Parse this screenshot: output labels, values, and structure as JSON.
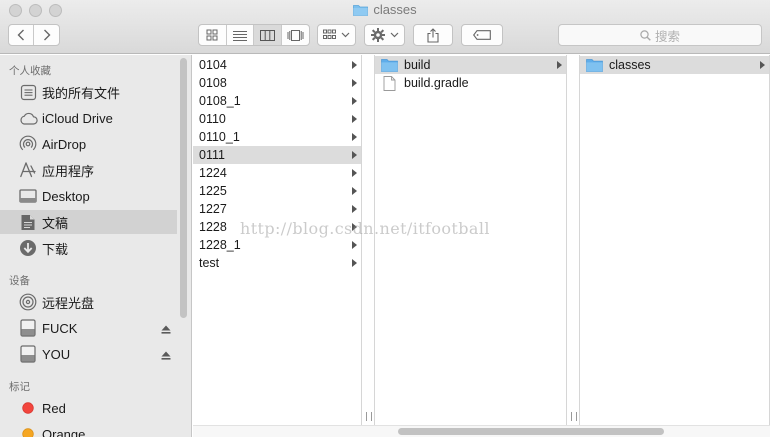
{
  "window": {
    "title": "classes"
  },
  "toolbar": {
    "search_placeholder": "搜索"
  },
  "sidebar": {
    "favorites_header": "个人收藏",
    "favorites": [
      {
        "label": "我的所有文件",
        "icon": "all-files-icon"
      },
      {
        "label": "iCloud Drive",
        "icon": "cloud-icon"
      },
      {
        "label": "AirDrop",
        "icon": "airdrop-icon"
      },
      {
        "label": "应用程序",
        "icon": "applications-icon"
      },
      {
        "label": "Desktop",
        "icon": "desktop-icon"
      },
      {
        "label": "文稿",
        "icon": "documents-icon",
        "selected": true
      },
      {
        "label": "下载",
        "icon": "downloads-icon"
      }
    ],
    "devices_header": "设备",
    "devices": [
      {
        "label": "远程光盘",
        "icon": "remote-disc-icon"
      },
      {
        "label": "FUCK",
        "icon": "drive-icon",
        "eject": true
      },
      {
        "label": "YOU",
        "icon": "drive-icon",
        "eject": true
      }
    ],
    "tags_header": "标记",
    "tags": [
      {
        "label": "Red",
        "color": "#f2453d"
      },
      {
        "label": "Orange",
        "color": "#f5a623"
      }
    ]
  },
  "column1": {
    "items": [
      "0104",
      "0108",
      "0108_1",
      "0110",
      "0110_1",
      "0111",
      "1224",
      "1225",
      "1227",
      "1228",
      "1228_1",
      "test"
    ],
    "selected": "0111"
  },
  "column2": {
    "items": [
      {
        "label": "build",
        "type": "folder",
        "selected": true
      },
      {
        "label": "build.gradle",
        "type": "file"
      }
    ]
  },
  "column3": {
    "items": [
      {
        "label": "classes",
        "type": "folder",
        "selected": true
      }
    ]
  },
  "watermark": "http://blog.csdn.net/itfootball",
  "colors": {
    "folder": "#6cb7ea",
    "selection": "#d2d2d2"
  }
}
